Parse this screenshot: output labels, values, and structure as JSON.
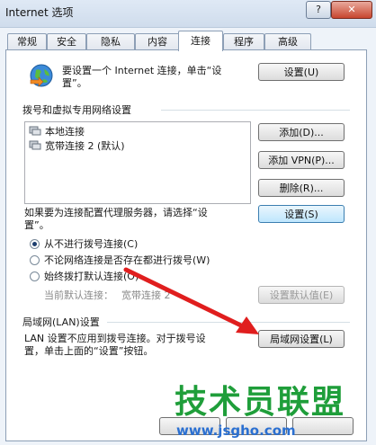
{
  "window": {
    "title": "Internet 选项",
    "help_label": "?",
    "close_label": "✕"
  },
  "tabs": [
    {
      "label": "常规"
    },
    {
      "label": "安全"
    },
    {
      "label": "隐私"
    },
    {
      "label": "内容"
    },
    {
      "label": "连接",
      "active": true
    },
    {
      "label": "程序"
    },
    {
      "label": "高级"
    }
  ],
  "setup": {
    "text_line1": "要设置一个 Internet 连接，单击“设",
    "text_line2": "置”。",
    "button_label": "设置(U)"
  },
  "dialup": {
    "heading": "拨号和虚拟专用网络设置",
    "connections": [
      {
        "label": "本地连接"
      },
      {
        "label": "宽带连接 2 (默认)"
      }
    ],
    "add_label": "添加(D)...",
    "add_vpn_label": "添加 VPN(P)...",
    "remove_label": "删除(R)...",
    "proxy_text_line1": "如果要为连接配置代理服务器，请选择“设",
    "proxy_text_line2": "置”。",
    "settings_label": "设置(S)",
    "options": [
      {
        "label": "从不进行拨号连接(C)",
        "selected": true
      },
      {
        "label": "不论网络连接是否存在都进行拨号(W)",
        "selected": false
      },
      {
        "label": "始终拨打默认连接(O)",
        "selected": false
      }
    ],
    "current_default_label": "当前默认连接：",
    "current_default_value": "宽带连接 2",
    "set_default_label": "设置默认值(E)"
  },
  "lan": {
    "heading": "局域网(LAN)设置",
    "text_line1": "LAN 设置不应用到拨号连接。对于拨号设",
    "text_line2": "置，单击上面的“设置”按钮。",
    "button_label": "局域网设置(L)"
  },
  "watermark": {
    "line1": "技术员联盟",
    "line2": "www.jsgho.com"
  },
  "colors": {
    "accent_red": "#e01e1e",
    "watermark_green": "#1f9e3a",
    "watermark_blue": "#2a6fd1"
  }
}
